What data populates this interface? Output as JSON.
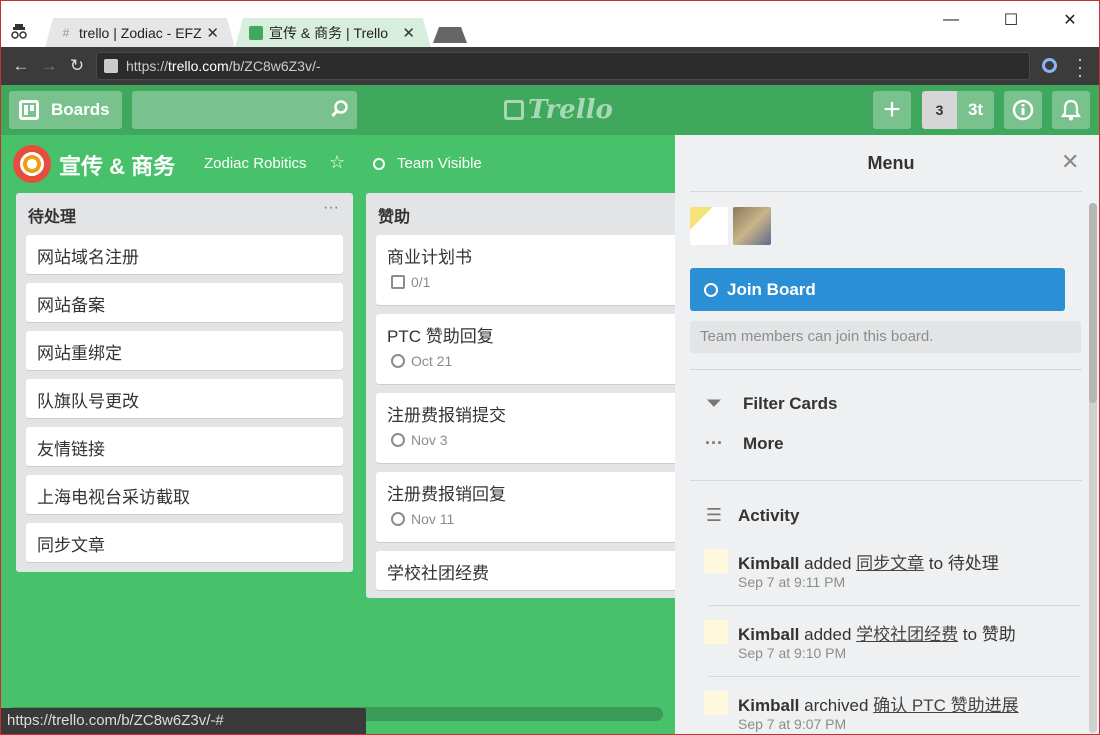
{
  "browser": {
    "tabs": [
      {
        "label": "trello | Zodiac - EFZ",
        "favicon": "#"
      },
      {
        "label": "宣传 & 商务 | Trello",
        "favicon": "trello-icon"
      }
    ],
    "url_prefix": "https://",
    "url_host": "trello.com",
    "url_path": "/b/ZC8w6Z3v/-",
    "status_url": "https://trello.com/b/ZC8w6Z3v/-#"
  },
  "header": {
    "boards_label": "Boards",
    "logo_text": "Trello",
    "count_a": "3",
    "count_b": "3t"
  },
  "board": {
    "name": "宣传 & 商务",
    "team": "Zodiac Robitics",
    "visibility": "Team Visible"
  },
  "lists": [
    {
      "title": "待处理",
      "cards": [
        {
          "title": "网站域名注册"
        },
        {
          "title": "网站备案"
        },
        {
          "title": "网站重绑定"
        },
        {
          "title": "队旗队号更改"
        },
        {
          "title": "友情链接"
        },
        {
          "title": "上海电视台采访截取"
        },
        {
          "title": "同步文章"
        }
      ]
    },
    {
      "title": "赞助",
      "cards": [
        {
          "title": "商业计划书",
          "badge": "0/1"
        },
        {
          "title": "PTC 赞助回复",
          "badge": "Oct 21"
        },
        {
          "title": "注册费报销提交",
          "badge": "Nov 3"
        },
        {
          "title": "注册费报销回复",
          "badge": "Nov 11"
        },
        {
          "title": "学校社团经费"
        }
      ]
    }
  ],
  "menu": {
    "title": "Menu",
    "join_label": "Join Board",
    "join_note": "Team members can join this board.",
    "filter_label": "Filter Cards",
    "more_label": "More",
    "activity_label": "Activity",
    "activities": [
      {
        "user": "Kimball",
        "action": "added",
        "target": "同步文章",
        "prep": "to",
        "dest": "待处理",
        "time": "Sep 7 at 9:11 PM"
      },
      {
        "user": "Kimball",
        "action": "added",
        "target": "学校社团经费",
        "prep": "to",
        "dest": "赞助",
        "time": "Sep 7 at 9:10 PM"
      },
      {
        "user": "Kimball",
        "action": "archived",
        "target": "确认 PTC 赞助进展",
        "prep": "",
        "dest": "",
        "time": "Sep 7 at 9:07 PM"
      }
    ]
  },
  "colors": {
    "board_bg": "#47c26a",
    "header_bg": "#3fa85c",
    "join_button": "#2a8fd5"
  }
}
